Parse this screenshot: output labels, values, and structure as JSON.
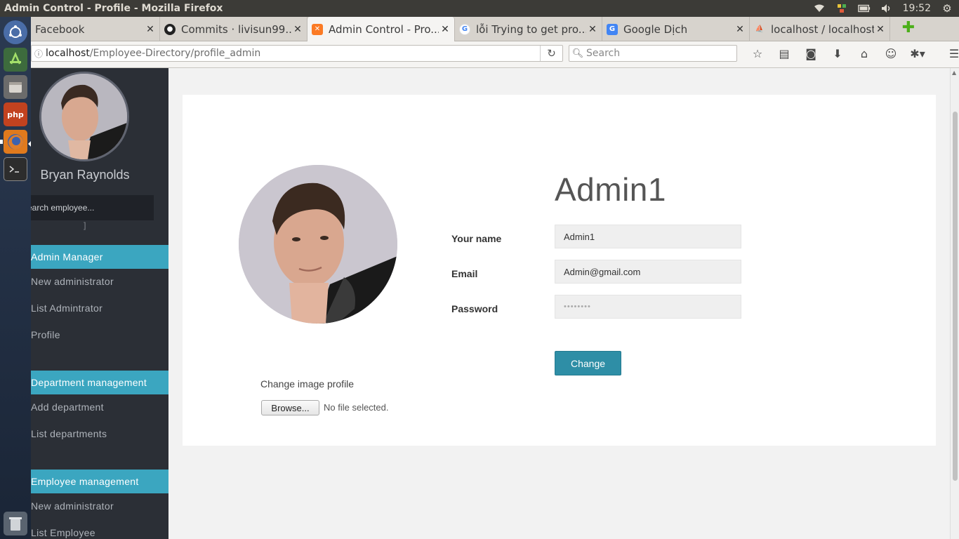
{
  "window": {
    "title": "Admin Control - Profile - Mozilla Firefox",
    "clock": "19:52"
  },
  "tabs": [
    {
      "label": "Facebook",
      "favicon": "facebook-icon"
    },
    {
      "label": "Commits · livisun99...",
      "favicon": "github-icon"
    },
    {
      "label": "Admin Control - Pro...",
      "favicon": "xampp-icon",
      "active": true
    },
    {
      "label": "lỗi Trying to get pro...",
      "favicon": "google-icon"
    },
    {
      "label": "Google Dịch",
      "favicon": "google-translate-icon"
    },
    {
      "label": "localhost / localhost...",
      "favicon": "phpmyadmin-icon"
    }
  ],
  "nav": {
    "url_host": "localhost",
    "url_path": "/Employee-Directory/profile_admin",
    "search_placeholder": "Search"
  },
  "sidebar": {
    "user_name": "Bryan Raynolds",
    "search_placeholder": "Search employee...",
    "sections": [
      {
        "title": "Admin Manager",
        "items": [
          "New administrator",
          "List Admintrator",
          "Profile"
        ]
      },
      {
        "title": "Department management",
        "items": [
          "Add department",
          "List departments"
        ]
      },
      {
        "title": "Employee management",
        "items": [
          "New administrator",
          "List Employee"
        ]
      }
    ]
  },
  "profile": {
    "heading": "Admin1",
    "name_label": "Your name",
    "name_value": "Admin1",
    "email_label": "Email",
    "email_value": "Admin@gmail.com",
    "password_label": "Password",
    "password_value": "••••••••",
    "change_button": "Change",
    "change_image_label": "Change image profile",
    "browse_button": "Browse...",
    "no_file_text": "No file selected."
  },
  "colors": {
    "accent": "#3ba6c0",
    "button": "#2e8ea6",
    "sidebar_bg": "#2b2f36"
  }
}
